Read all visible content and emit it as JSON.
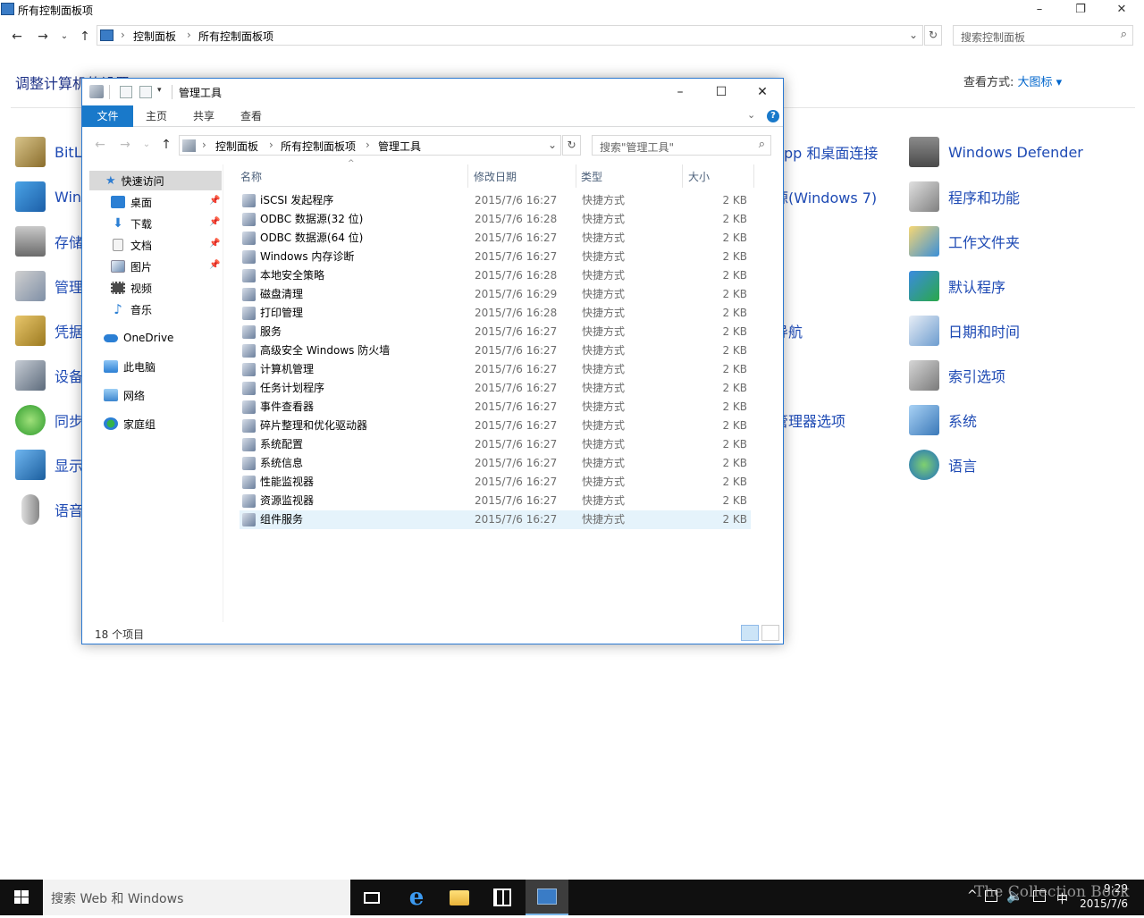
{
  "control_panel": {
    "title": "所有控制面板项",
    "breadcrumb": [
      "控制面板",
      "所有控制面板项"
    ],
    "search_placeholder": "搜索控制面板",
    "heading": "调整计算机的设置",
    "view_by_label": "查看方式:",
    "view_by_value": "大图标 ▾",
    "left_items": [
      "BitL",
      "Win",
      "存储",
      "管理",
      "凭据",
      "设备",
      "同步",
      "显示",
      "语音"
    ],
    "middle_items": [
      {
        "label": "App 和桌面连接",
        "row": 0
      },
      {
        "label": "源(Windows 7)",
        "row": 1
      },
      {
        "label": "导航",
        "row": 4
      },
      {
        "label": "管理器选项",
        "row": 6
      }
    ],
    "right_items": [
      "Windows Defender",
      "程序和功能",
      "工作文件夹",
      "默认程序",
      "日期和时间",
      "索引选项",
      "系统",
      "语言"
    ]
  },
  "explorer": {
    "title": "管理工具",
    "ribbon_tabs": [
      "文件",
      "主页",
      "共享",
      "查看"
    ],
    "breadcrumb": [
      "控制面板",
      "所有控制面板项",
      "管理工具"
    ],
    "search_placeholder": "搜索\"管理工具\"",
    "nav": {
      "quick_access": "快速访问",
      "quick_items": [
        "桌面",
        "下载",
        "文档",
        "图片",
        "视频",
        "音乐"
      ],
      "onedrive": "OneDrive",
      "this_pc": "此电脑",
      "network": "网络",
      "homegroup": "家庭组"
    },
    "columns": {
      "name": "名称",
      "date": "修改日期",
      "type": "类型",
      "size": "大小"
    },
    "files": [
      {
        "name": "iSCSI 发起程序",
        "date": "2015/7/6 16:27",
        "type": "快捷方式",
        "size": "2 KB"
      },
      {
        "name": "ODBC 数据源(32 位)",
        "date": "2015/7/6 16:28",
        "type": "快捷方式",
        "size": "2 KB"
      },
      {
        "name": "ODBC 数据源(64 位)",
        "date": "2015/7/6 16:27",
        "type": "快捷方式",
        "size": "2 KB"
      },
      {
        "name": "Windows 内存诊断",
        "date": "2015/7/6 16:27",
        "type": "快捷方式",
        "size": "2 KB"
      },
      {
        "name": "本地安全策略",
        "date": "2015/7/6 16:28",
        "type": "快捷方式",
        "size": "2 KB"
      },
      {
        "name": "磁盘清理",
        "date": "2015/7/6 16:29",
        "type": "快捷方式",
        "size": "2 KB"
      },
      {
        "name": "打印管理",
        "date": "2015/7/6 16:28",
        "type": "快捷方式",
        "size": "2 KB"
      },
      {
        "name": "服务",
        "date": "2015/7/6 16:27",
        "type": "快捷方式",
        "size": "2 KB"
      },
      {
        "name": "高级安全 Windows 防火墙",
        "date": "2015/7/6 16:27",
        "type": "快捷方式",
        "size": "2 KB"
      },
      {
        "name": "计算机管理",
        "date": "2015/7/6 16:27",
        "type": "快捷方式",
        "size": "2 KB"
      },
      {
        "name": "任务计划程序",
        "date": "2015/7/6 16:27",
        "type": "快捷方式",
        "size": "2 KB"
      },
      {
        "name": "事件查看器",
        "date": "2015/7/6 16:27",
        "type": "快捷方式",
        "size": "2 KB"
      },
      {
        "name": "碎片整理和优化驱动器",
        "date": "2015/7/6 16:27",
        "type": "快捷方式",
        "size": "2 KB"
      },
      {
        "name": "系统配置",
        "date": "2015/7/6 16:27",
        "type": "快捷方式",
        "size": "2 KB"
      },
      {
        "name": "系统信息",
        "date": "2015/7/6 16:27",
        "type": "快捷方式",
        "size": "2 KB"
      },
      {
        "name": "性能监视器",
        "date": "2015/7/6 16:27",
        "type": "快捷方式",
        "size": "2 KB"
      },
      {
        "name": "资源监视器",
        "date": "2015/7/6 16:27",
        "type": "快捷方式",
        "size": "2 KB"
      },
      {
        "name": "组件服务",
        "date": "2015/7/6 16:27",
        "type": "快捷方式",
        "size": "2 KB"
      }
    ],
    "selected_index": 17,
    "status": "18 个项目"
  },
  "taskbar": {
    "search_placeholder": "搜索 Web 和 Windows",
    "ime": "中",
    "time": "9:29",
    "date": "2015/7/6"
  },
  "watermark": "The Collection Book",
  "colors": {
    "accent": "#1979ca",
    "link": "#1e4ab4",
    "heading": "#1e3287",
    "selection": "#e5f3fb"
  }
}
